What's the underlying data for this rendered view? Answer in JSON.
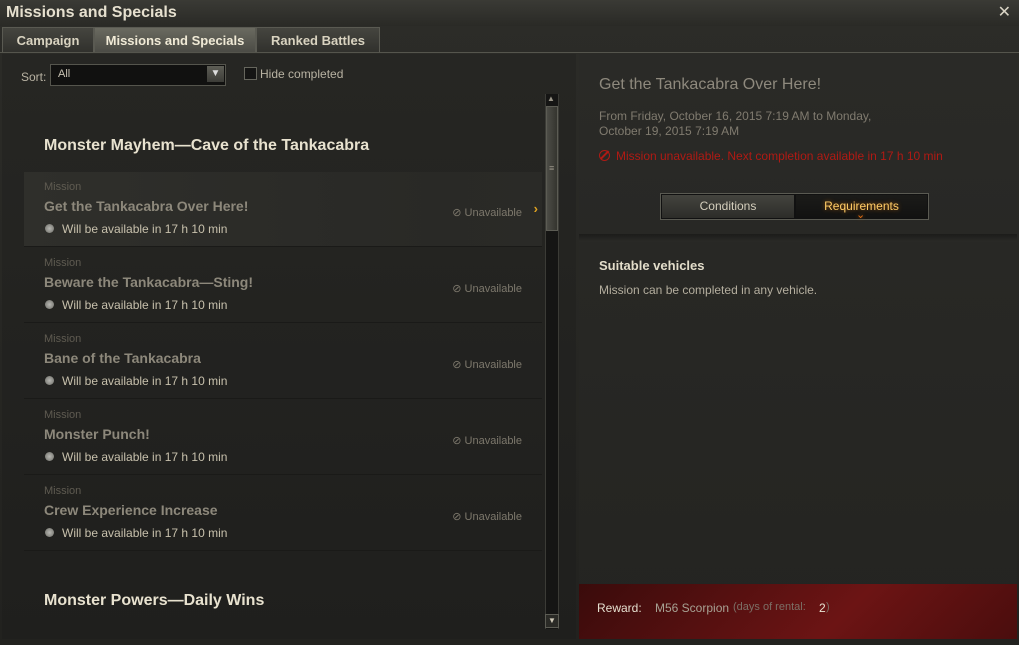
{
  "window": {
    "title": "Missions and Specials",
    "close_icon": "close-icon"
  },
  "tabs": [
    {
      "label": "Campaign",
      "active": false
    },
    {
      "label": "Missions and Specials",
      "active": true
    },
    {
      "label": "Ranked Battles",
      "active": false
    }
  ],
  "filters": {
    "sort_label": "Sort:",
    "sort_value": "All",
    "hide_completed_label": "Hide completed",
    "hide_completed_checked": false
  },
  "groups": [
    {
      "title": "Monster Mayhem—Cave of the Tankacabra",
      "missions": [
        {
          "kind": "Mission",
          "name": "Get the Tankacabra Over Here!",
          "availability": "Will be available in 17 h 10 min",
          "status": "Unavailable",
          "selected": true
        },
        {
          "kind": "Mission",
          "name": "Beware the Tankacabra—Sting!",
          "availability": "Will be available in 17 h 10 min",
          "status": "Unavailable",
          "selected": false
        },
        {
          "kind": "Mission",
          "name": "Bane of the Tankacabra",
          "availability": "Will be available in 17 h 10 min",
          "status": "Unavailable",
          "selected": false
        },
        {
          "kind": "Mission",
          "name": "Monster Punch!",
          "availability": "Will be available in 17 h 10 min",
          "status": "Unavailable",
          "selected": false
        },
        {
          "kind": "Mission",
          "name": "Crew Experience Increase",
          "availability": "Will be available in 17 h 10 min",
          "status": "Unavailable",
          "selected": false
        }
      ]
    },
    {
      "title": "Monster Powers—Daily Wins",
      "missions": []
    }
  ],
  "detail": {
    "title": "Get the Tankacabra Over Here!",
    "period": "From Friday, October 16, 2015 7:19 AM to Monday, October 19, 2015 7:19 AM",
    "warning": "Mission unavailable. Next completion available in 17 h 10 min",
    "buttons": {
      "conditions": "Conditions",
      "requirements": "Requirements",
      "active": "requirements"
    },
    "suitable_title": "Suitable vehicles",
    "suitable_text": "Mission can be completed in any vehicle.",
    "reward": {
      "label": "Reward:",
      "vehicle": "M56 Scorpion",
      "rental_text": "(days of rental:",
      "days": "2",
      "close_paren": ")"
    }
  },
  "colors": {
    "accent": "#e0a321",
    "warning": "#b01a14",
    "reward_bg": "#6c1414"
  }
}
